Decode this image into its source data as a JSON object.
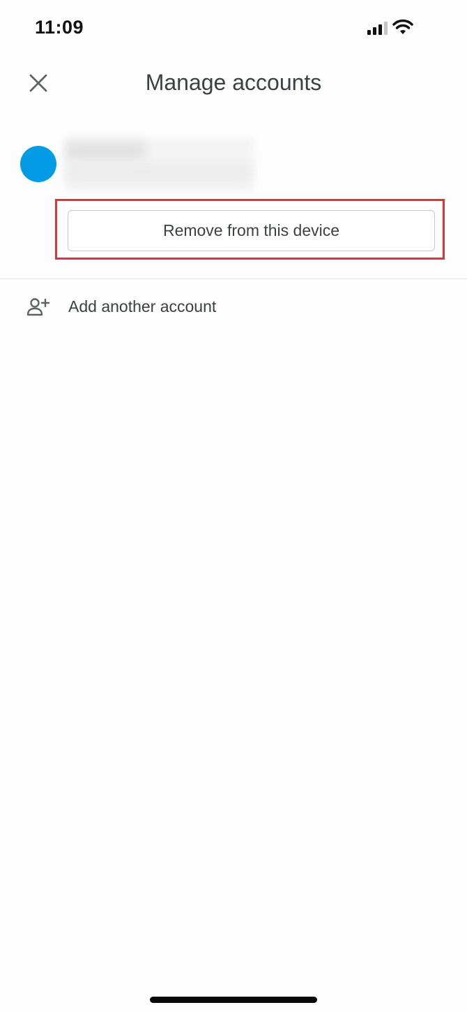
{
  "status_bar": {
    "time": "11:09",
    "icons": [
      "signal-icon",
      "wifi-icon"
    ]
  },
  "header": {
    "close_icon": "close-icon",
    "title": "Manage accounts"
  },
  "account": {
    "avatar_color": "#039be5",
    "remove_label": "Remove from this device"
  },
  "add_account": {
    "icon": "add-person-icon",
    "label": "Add another account"
  },
  "colors": {
    "highlight": "#e0313c",
    "text": "#3c4043"
  }
}
